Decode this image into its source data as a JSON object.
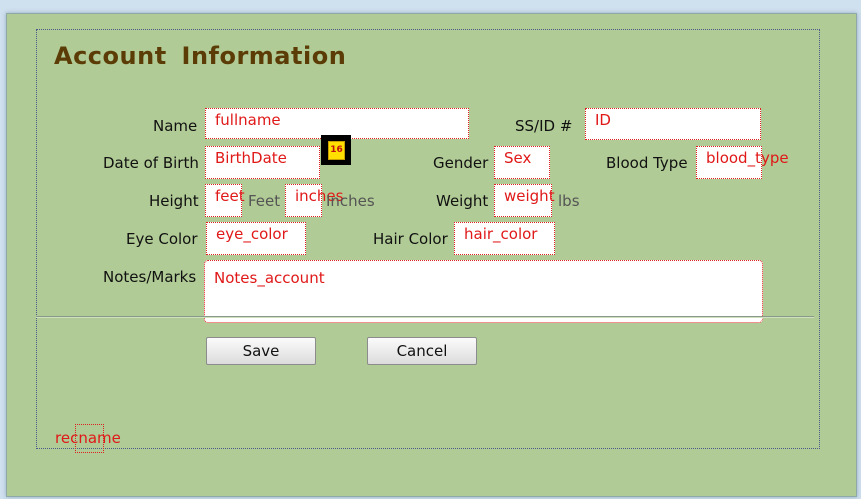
{
  "form": {
    "title": "Account Information",
    "labels": {
      "name": "Name",
      "ssid": "SS/ID #",
      "dob": "Date of Birth",
      "gender": "Gender",
      "blood_type": "Blood Type",
      "height": "Height",
      "weight": "Weight",
      "eye_color": "Eye Color",
      "hair_color": "Hair Color",
      "notes": "Notes/Marks"
    },
    "fields": {
      "name": "fullname",
      "ssid": "ID",
      "dob": "BirthDate",
      "gender": "Sex",
      "blood_type": "blood_type",
      "height_feet": "feet",
      "height_inches": "inches",
      "weight": "weight",
      "eye_color": "eye_color",
      "hair_color": "hair_color",
      "notes": "Notes_account"
    },
    "units": {
      "feet": "Feet",
      "inches": "Inches",
      "weight": "lbs"
    },
    "calendar_day": "16",
    "buttons": {
      "save": "Save",
      "cancel": "Cancel"
    },
    "footer_field": "recname"
  },
  "colors": {
    "background": "#b0cb95",
    "title": "#5c3c06",
    "field_text": "#e01818"
  }
}
